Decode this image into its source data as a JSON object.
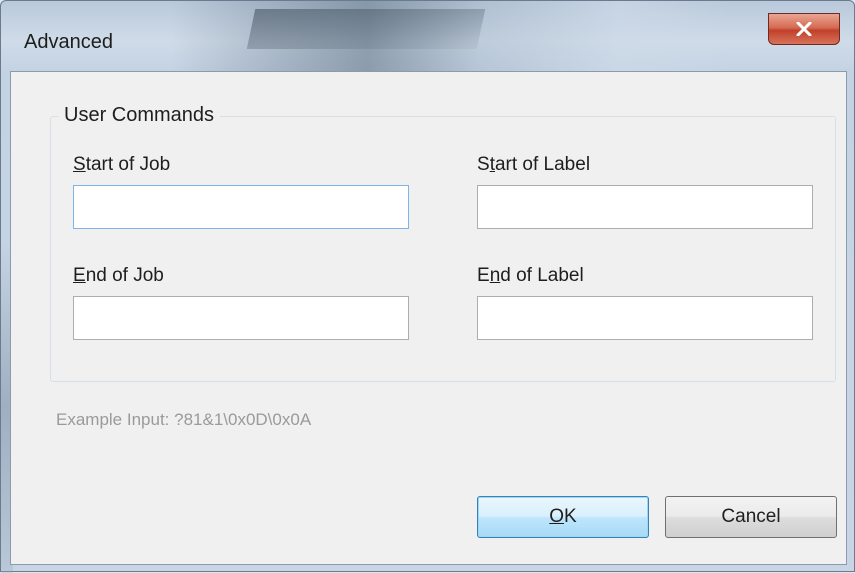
{
  "window": {
    "title": "Advanced",
    "close_icon": "close-icon"
  },
  "group": {
    "label": "User Commands"
  },
  "fields": {
    "start_of_job": {
      "mnemonic": "S",
      "rest": "tart of Job",
      "value": ""
    },
    "start_of_label": {
      "pre": "S",
      "mnemonic": "t",
      "rest": "art of Label",
      "value": ""
    },
    "end_of_job": {
      "mnemonic": "E",
      "rest": "nd of Job",
      "value": ""
    },
    "end_of_label": {
      "pre": "E",
      "mnemonic": "n",
      "rest": "d of Label",
      "value": ""
    }
  },
  "example_text": "Example Input: ?81&1\\0x0D\\0x0A",
  "buttons": {
    "ok": {
      "mnemonic": "O",
      "rest": "K"
    },
    "cancel": "Cancel"
  },
  "colors": {
    "close_button": "#c7452e",
    "default_button_border": "#3c7fb1",
    "hint_text": "#9a9a9a"
  }
}
